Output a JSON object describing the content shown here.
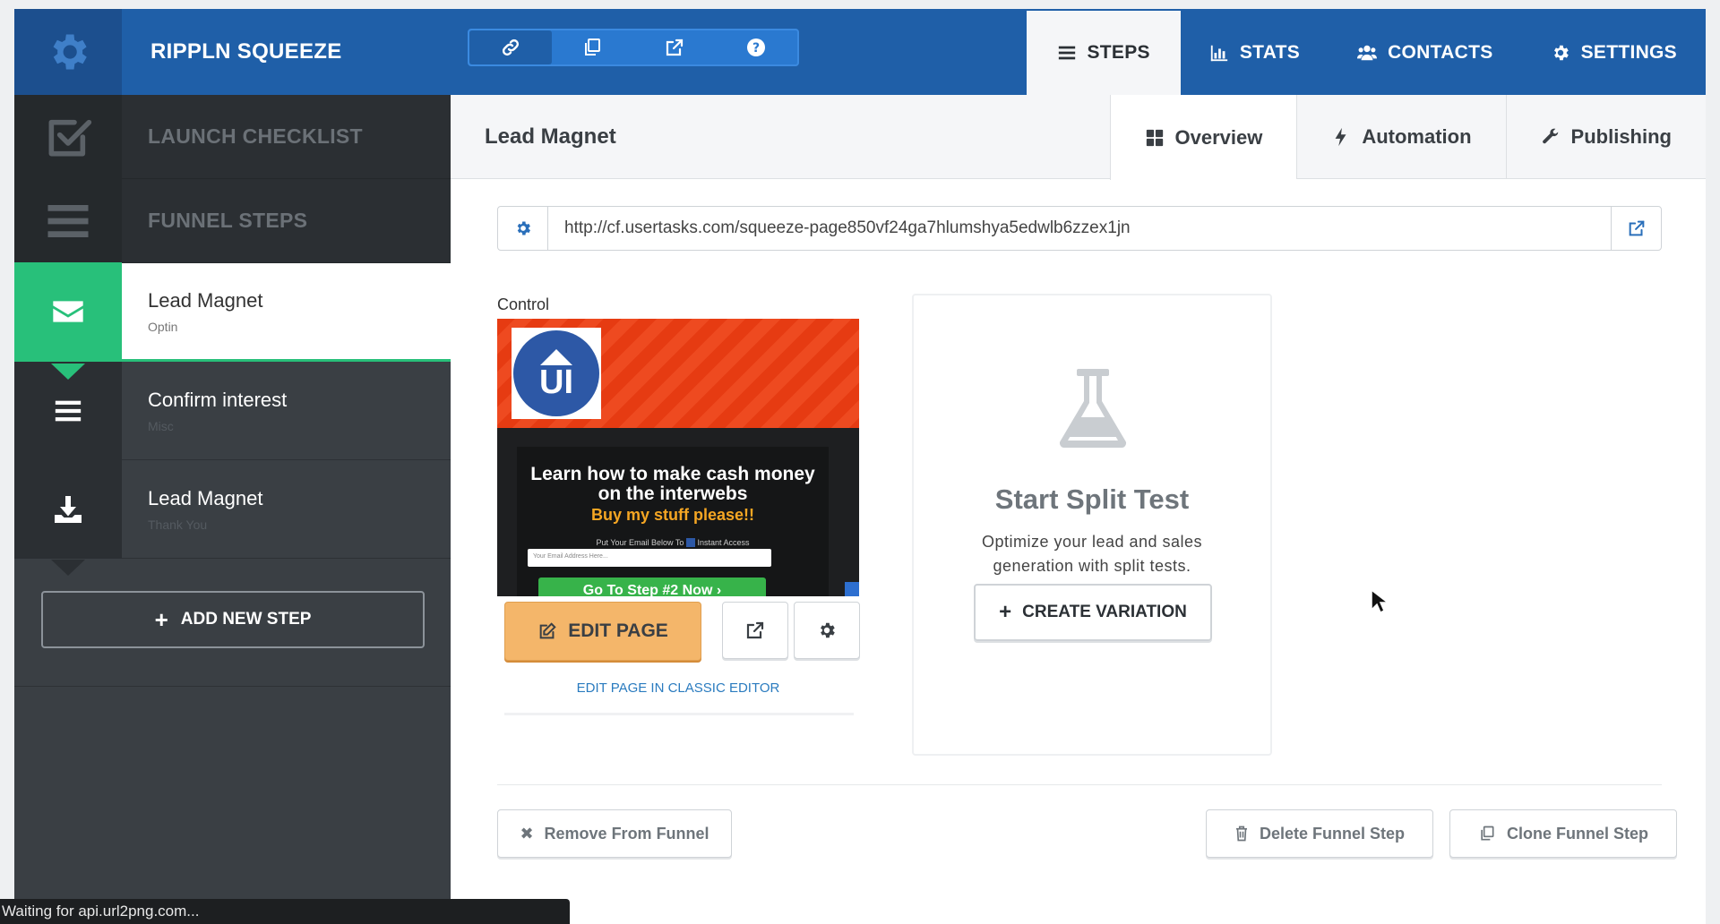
{
  "header": {
    "brand": "RIPPLN SQUEEZE",
    "tools": [
      {
        "icon": "link-icon"
      },
      {
        "icon": "clone-icon"
      },
      {
        "icon": "external-link-icon"
      },
      {
        "icon": "help-icon"
      }
    ],
    "nav": [
      {
        "label": "STEPS",
        "icon": "list-icon",
        "active": true
      },
      {
        "label": "STATS",
        "icon": "bar-chart-icon"
      },
      {
        "label": "CONTACTS",
        "icon": "users-icon"
      },
      {
        "label": "SETTINGS",
        "icon": "gear-icon"
      }
    ]
  },
  "sidebar": {
    "launch_checklist": "LAUNCH CHECKLIST",
    "funnel_steps": "FUNNEL STEPS",
    "steps": [
      {
        "name": "Lead Magnet",
        "type": "Optin",
        "icon": "envelope-icon",
        "active": true
      },
      {
        "name": "Confirm interest",
        "type": "Misc",
        "icon": "list-icon"
      },
      {
        "name": "Lead Magnet",
        "type": "Thank You",
        "icon": "download-icon"
      }
    ],
    "add_step": "ADD NEW STEP"
  },
  "main": {
    "title": "Lead Magnet",
    "tabs": [
      {
        "label": "Overview",
        "icon": "grid-icon",
        "active": true
      },
      {
        "label": "Automation",
        "icon": "bolt-icon"
      },
      {
        "label": "Publishing",
        "icon": "wrench-icon"
      }
    ],
    "url": "http://cf.usertasks.com/squeeze-page850vf24ga7hlumshya5edwlb6zzex1jn",
    "control_label": "Control",
    "preview": {
      "logo_text": "UI",
      "headline": "Learn how to make cash money on the interwebs",
      "subheadline": "Buy my stuff please!!",
      "small_text": "Put Your Email Below To",
      "small_text_tail": "Instant Access",
      "email_placeholder": "Your Email Address Here...",
      "cta": "Go To Step #2 Now"
    },
    "edit_page": "EDIT PAGE",
    "classic_editor": "EDIT PAGE IN CLASSIC EDITOR",
    "split_test": {
      "title": "Start Split Test",
      "description": "Optimize your lead and sales generation with split tests.",
      "button": "CREATE VARIATION"
    },
    "footer": {
      "remove": "Remove From Funnel",
      "delete": "Delete Funnel Step",
      "clone": "Clone Funnel Step"
    }
  },
  "status_bar": "Waiting for api.url2png.com...",
  "colors": {
    "header_blue": "#1f5fa8",
    "active_green": "#28c07a",
    "edit_orange": "#f4b66a",
    "sidebar_dark": "#3a3f44"
  }
}
